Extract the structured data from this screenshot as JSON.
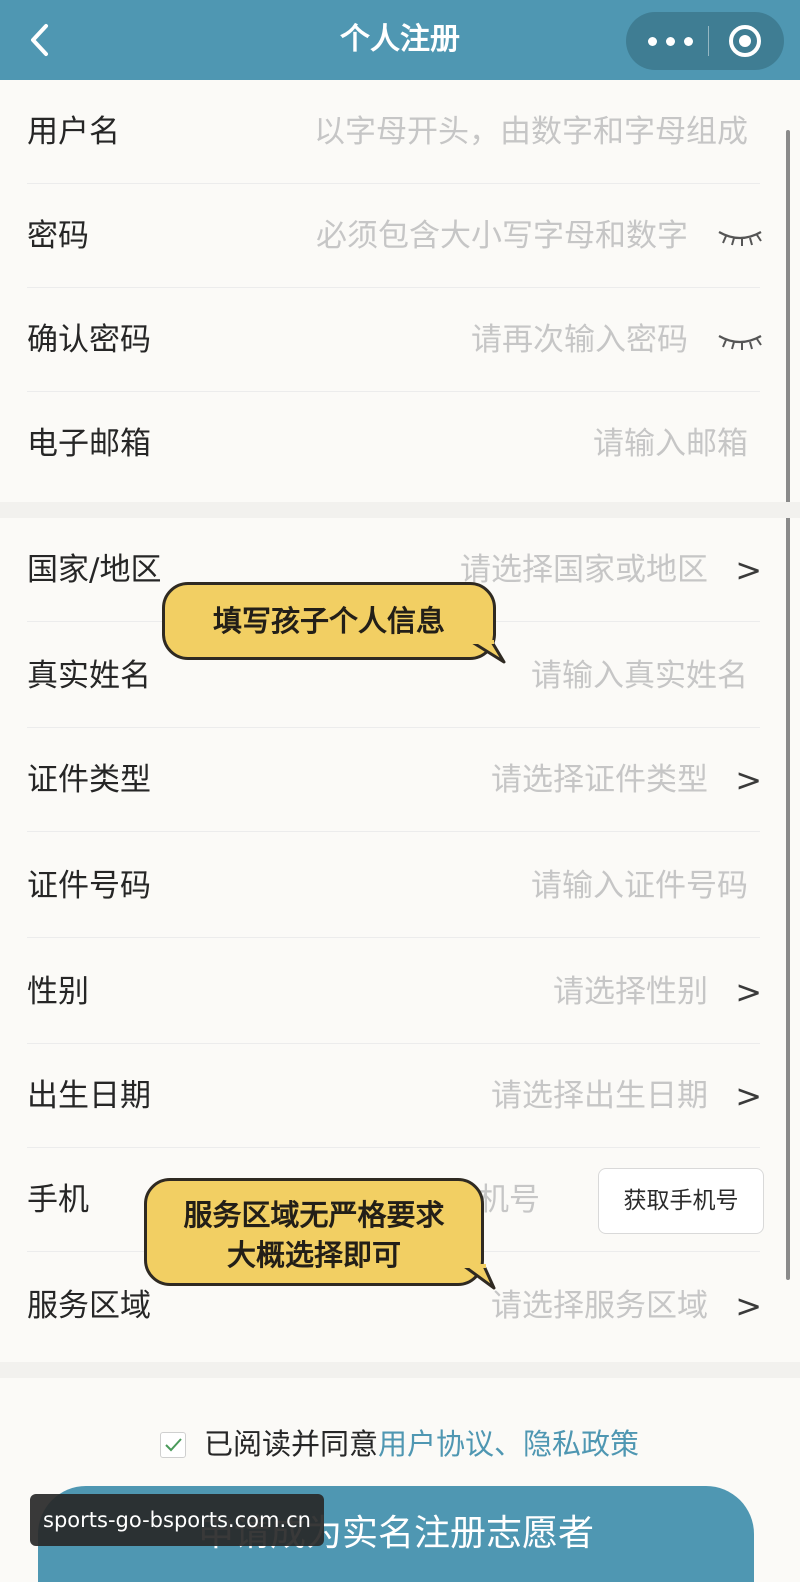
{
  "header": {
    "title": "个人注册",
    "back_icon": "chevron-left-icon",
    "more_icon": "more-dots-icon",
    "close_icon": "miniprogram-close-icon",
    "bar_color": "#4f97b2"
  },
  "form": {
    "username": {
      "label": "用户名",
      "placeholder": "以字母开头，由数字和字母组成"
    },
    "password": {
      "label": "密码",
      "placeholder": "必须包含大小写字母和数字",
      "toggle_icon": "eye-closed-icon"
    },
    "confirm_password": {
      "label": "确认密码",
      "placeholder": "请再次输入密码",
      "toggle_icon": "eye-closed-icon"
    },
    "email": {
      "label": "电子邮箱",
      "placeholder": "请输入邮箱"
    },
    "country": {
      "label": "国家/地区",
      "placeholder": "请选择国家或地区"
    },
    "real_name": {
      "label": "真实姓名",
      "placeholder": "请输入真实姓名"
    },
    "id_type": {
      "label": "证件类型",
      "placeholder": "请选择证件类型"
    },
    "id_number": {
      "label": "证件号码",
      "placeholder": "请输入证件号码"
    },
    "gender": {
      "label": "性别",
      "placeholder": "请选择性别"
    },
    "birth_date": {
      "label": "出生日期",
      "placeholder": "请选择出生日期"
    },
    "phone": {
      "label": "手机",
      "placeholder_visible_fragment": "机号",
      "get_phone_button": "获取手机号"
    },
    "service_area": {
      "label": "服务区域",
      "placeholder": "请选择服务区域"
    },
    "chevron": ">"
  },
  "annotations": {
    "bubble1": "填写孩子个人信息",
    "bubble2_line1": "服务区域无严格要求",
    "bubble2_line2": "大概选择即可",
    "bubble_color": "#f2cf63"
  },
  "agreement": {
    "checked": true,
    "prefix": "已阅读并同意",
    "user_agreement": "用户协议",
    "separator": "、",
    "privacy_policy": "隐私政策",
    "link_color": "#4f97b2"
  },
  "submit": {
    "label": "申请成为实名注册志愿者"
  },
  "watermark": {
    "text": "sports-go-bsports.com.cn"
  }
}
